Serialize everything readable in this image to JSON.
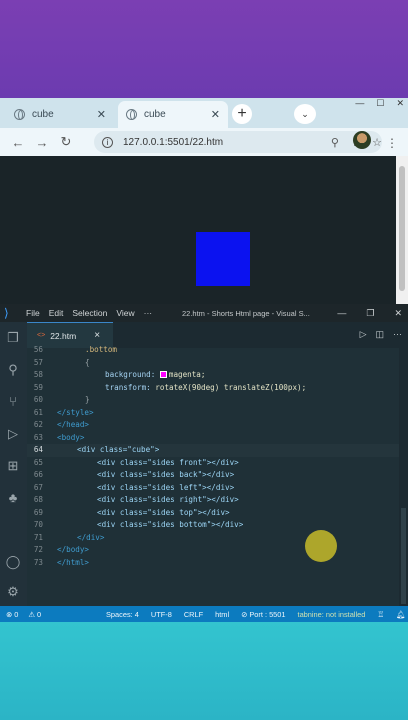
{
  "browser": {
    "tabs": [
      {
        "title": "cube",
        "active": false
      },
      {
        "title": "cube",
        "active": true
      }
    ],
    "new_tab": "+",
    "url": "127.0.0.1:5501/22.htm",
    "page": {
      "background": "#1a2428",
      "cube_color": "#0b12f0"
    }
  },
  "vscode": {
    "menu": [
      "File",
      "Edit",
      "Selection",
      "View",
      "···"
    ],
    "title": "22.htm - Shorts Html page - Visual S...",
    "tab": {
      "name": "22.htm",
      "icon": "<>",
      "close": "×"
    },
    "code_lines": [
      {
        "n": "56",
        "text": ".bottom"
      },
      {
        "n": "57",
        "text": "{"
      },
      {
        "n": "58",
        "prop": "background:",
        "val": "magenta;"
      },
      {
        "n": "59",
        "prop": "transform:",
        "val": "rotateX(90deg) translateZ(100px);"
      },
      {
        "n": "60",
        "text": "}"
      },
      {
        "n": "61",
        "text": "</style>"
      },
      {
        "n": "62",
        "text": "</head>"
      },
      {
        "n": "63",
        "text": "<body>"
      },
      {
        "n": "64",
        "text": "<div class=\"cube\">"
      },
      {
        "n": "65",
        "text": "<div class=\"sides front\"></div>"
      },
      {
        "n": "66",
        "text": "<div class=\"sides back\"></div>"
      },
      {
        "n": "67",
        "text": "<div class=\"sides left\"></div>"
      },
      {
        "n": "68",
        "text": "<div class=\"sides right\"></div>"
      },
      {
        "n": "69",
        "text": "<div class=\"sides top\"></div>"
      },
      {
        "n": "70",
        "text": "<div class=\"sides bottom\"></div>"
      },
      {
        "n": "71",
        "text": "</div>"
      },
      {
        "n": "72",
        "text": "</body>"
      },
      {
        "n": "73",
        "text": "</html>"
      }
    ],
    "status": {
      "errors": "⊗ 0",
      "warnings": "⚠ 0",
      "spaces": "Spaces: 4",
      "encoding": "UTF-8",
      "eol": "CRLF",
      "language": "html",
      "port": "⊘ Port : 5501",
      "ext": "tabnine: not installed"
    }
  },
  "colors": {
    "top_band": "#7b3fb3",
    "bottom_band": "#33c4cf",
    "status_bar": "#0c7bbf",
    "accent_magenta": "#ff00ff"
  }
}
